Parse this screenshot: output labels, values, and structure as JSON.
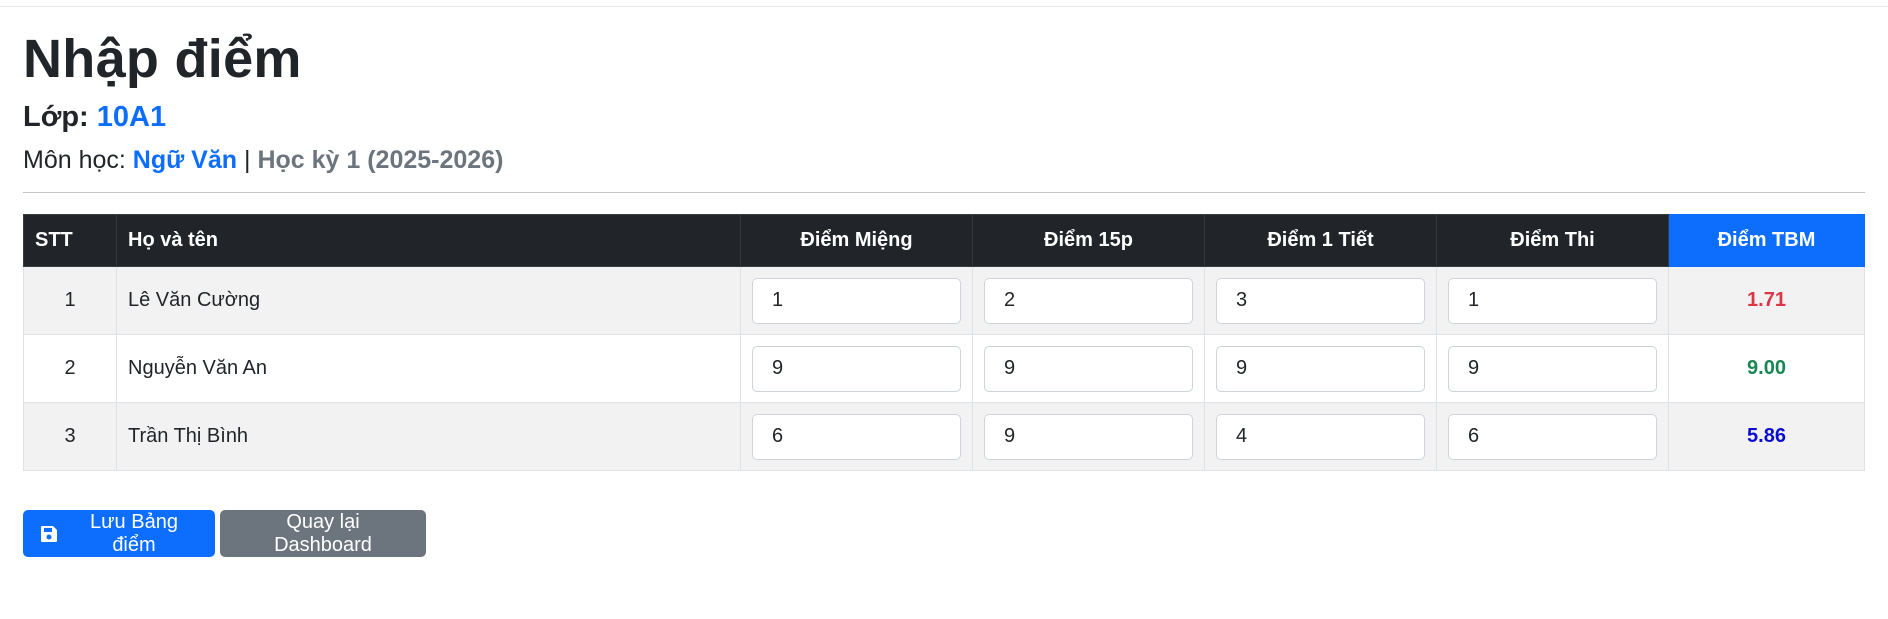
{
  "page": {
    "title": "Nhập điểm",
    "class_label": "Lớp:",
    "class_value": "10A1",
    "subject_label": "Môn học:",
    "subject_value": "Ngữ Văn",
    "separator": "|",
    "term": "Học kỳ 1 (2025-2026)"
  },
  "table": {
    "headers": {
      "stt": "STT",
      "name": "Họ và tên",
      "mieng": "Điểm Miệng",
      "p15": "Điểm 15p",
      "tiet1": "Điểm 1 Tiết",
      "thi": "Điểm Thi",
      "tbm": "Điểm TBM"
    },
    "rows": [
      {
        "stt": "1",
        "name": "Lê Văn Cường",
        "mieng": "1",
        "p15": "2",
        "tiet1": "3",
        "thi": "1",
        "tbm": "1.71",
        "tbm_color": "#dc3545"
      },
      {
        "stt": "2",
        "name": "Nguyễn Văn An",
        "mieng": "9",
        "p15": "9",
        "tiet1": "9",
        "thi": "9",
        "tbm": "9.00",
        "tbm_color": "#198754"
      },
      {
        "stt": "3",
        "name": "Trần Thị Bình",
        "mieng": "6",
        "p15": "9",
        "tiet1": "4",
        "thi": "6",
        "tbm": "5.86",
        "tbm_color": "#0d0dcf"
      }
    ]
  },
  "actions": {
    "save_label": "Lưu Bảng điểm",
    "save_icon": "floppy-disk-icon",
    "back_label": "Quay lại Dashboard"
  },
  "colors": {
    "primary": "#0d6efd",
    "secondary": "#6c757d",
    "header_dark": "#212529"
  }
}
